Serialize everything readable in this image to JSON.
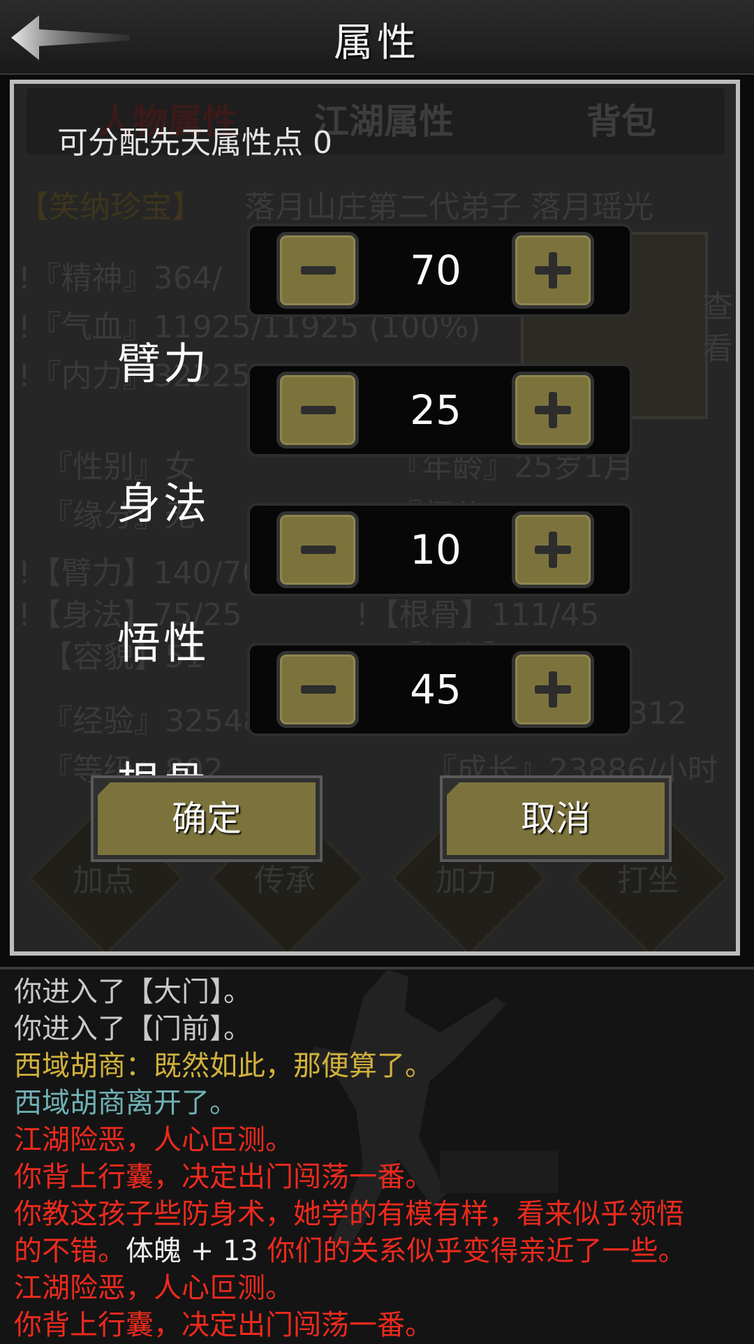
{
  "header": {
    "title": "属性"
  },
  "background_panel": {
    "tabs": [
      "人物属性",
      "江湖属性",
      "背包"
    ],
    "title_line": {
      "prefix": "【笑纳珍宝】",
      "name": "落月山庄第二代弟子 落月瑶光"
    },
    "stat_lines": [
      "!『精神』364/",
      "!『气血』11925/11925 (100%)",
      "!『内力』32225/",
      "『性别』女",
      "『缘分』无",
      "!【臂力】140/70",
      "!【身法】75/25",
      "【容貌】51",
      "『经验』32548",
      "『等级』802"
    ],
    "right_lines": [
      "『年龄』25岁1月",
      "『师父』",
      "!【根骨】111/45",
      "【福缘】",
      "312",
      "『成长』23886/小时"
    ],
    "side_button": "查看",
    "actions": [
      "加点",
      "传承",
      "加力",
      "打坐"
    ]
  },
  "dialog": {
    "points_label": "可分配先天属性点 0",
    "attributes": [
      {
        "label": "臂力",
        "value": "70"
      },
      {
        "label": "身法",
        "value": "25"
      },
      {
        "label": "悟性",
        "value": "10"
      },
      {
        "label": "根骨",
        "value": "45"
      }
    ],
    "confirm_label": "确定",
    "cancel_label": "取消"
  },
  "log": {
    "lines": [
      {
        "text": "你进入了【大门】。"
      },
      {
        "text": "你进入了【门前】。"
      },
      {
        "text": "西域胡商：既然如此，那便算了。"
      },
      {
        "text": "西域胡商离开了。"
      },
      {
        "text": "江湖险恶，人心叵测。"
      },
      {
        "text": "你背上行囊，决定出门闯荡一番。"
      },
      {
        "text": "你教这孩子些防身术，她学的有模有样，看来似乎领悟"
      },
      {
        "parts": [
          "的不错。",
          "体魄 + 13",
          " 你们的关系似乎变得亲近了一些。"
        ]
      },
      {
        "text": "江湖险恶，人心叵测。"
      },
      {
        "text": "你背上行囊，决定出门闯荡一番。"
      }
    ]
  },
  "colors": {
    "button_olive": "#7c733c",
    "log_gray": "#c9c9c9",
    "log_yellow": "#d2b23c",
    "log_teal": "#6fb1b5",
    "log_red": "#ee2a1d"
  }
}
